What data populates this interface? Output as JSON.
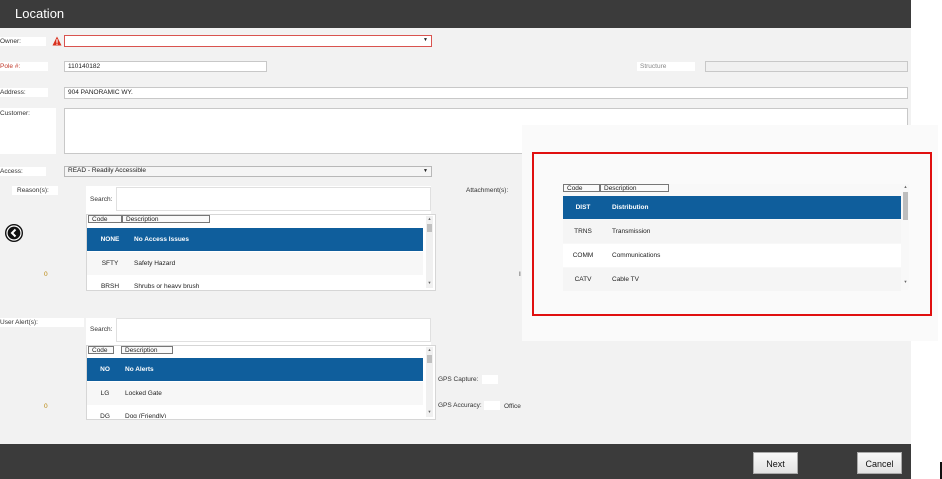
{
  "header": {
    "title": "Location"
  },
  "form": {
    "owner_label": "Owner:",
    "owner_value": "",
    "pole_label": "Pole #:",
    "pole_value": "110140182",
    "structure_label": "Structure",
    "structure_value": "",
    "address_label": "Address:",
    "address_value": "904 PANORAMIC WY.",
    "customer_label": "Customer:",
    "customer_value": "",
    "access_label": "Access:",
    "access_value": "READ - Readily Accessible",
    "reasons_label": "Reason(s):",
    "reasons_count": "0",
    "attachments_label": "Attachment(s):",
    "attachments_count": "I",
    "user_alerts_label": "User Alert(s):",
    "user_alerts_count": "0",
    "gps_capture_label": "GPS Capture:",
    "gps_capture_value": "",
    "gps_accuracy_label": "GPS Accuracy:",
    "gps_accuracy_value": "Office"
  },
  "reasons_list": {
    "search_label": "Search:",
    "search_value": "",
    "columns": [
      "Code",
      "Description"
    ],
    "rows": [
      {
        "code": "NONE",
        "description": "No Access Issues"
      },
      {
        "code": "SFTY",
        "description": "Safety Hazard"
      },
      {
        "code": "BRSH",
        "description": "Shrubs or heavy brush"
      }
    ]
  },
  "alerts_list": {
    "search_label": "Search:",
    "search_value": "",
    "columns": [
      "Code",
      "Description"
    ],
    "rows": [
      {
        "code": "NO",
        "description": "No Alerts"
      },
      {
        "code": "LG",
        "description": "Locked Gate"
      },
      {
        "code": "DG",
        "description": "Dog (Friendly)"
      }
    ]
  },
  "attachments_list": {
    "columns": [
      "Code",
      "Description"
    ],
    "rows": [
      {
        "code": "DIST",
        "description": "Distribution"
      },
      {
        "code": "TRNS",
        "description": "Transmission"
      },
      {
        "code": "COMM",
        "description": "Communications"
      },
      {
        "code": "CATV",
        "description": "Cable TV"
      }
    ]
  },
  "footer": {
    "next_label": "Next",
    "cancel_label": "Cancel"
  },
  "colors": {
    "header_bg": "#3b3b3b",
    "selected_row": "#0f5e9c",
    "highlight_frame": "#e01010",
    "required_field_border": "#d9534f"
  },
  "icons": {
    "warning": "warning-icon",
    "back": "back-arrow-icon"
  }
}
